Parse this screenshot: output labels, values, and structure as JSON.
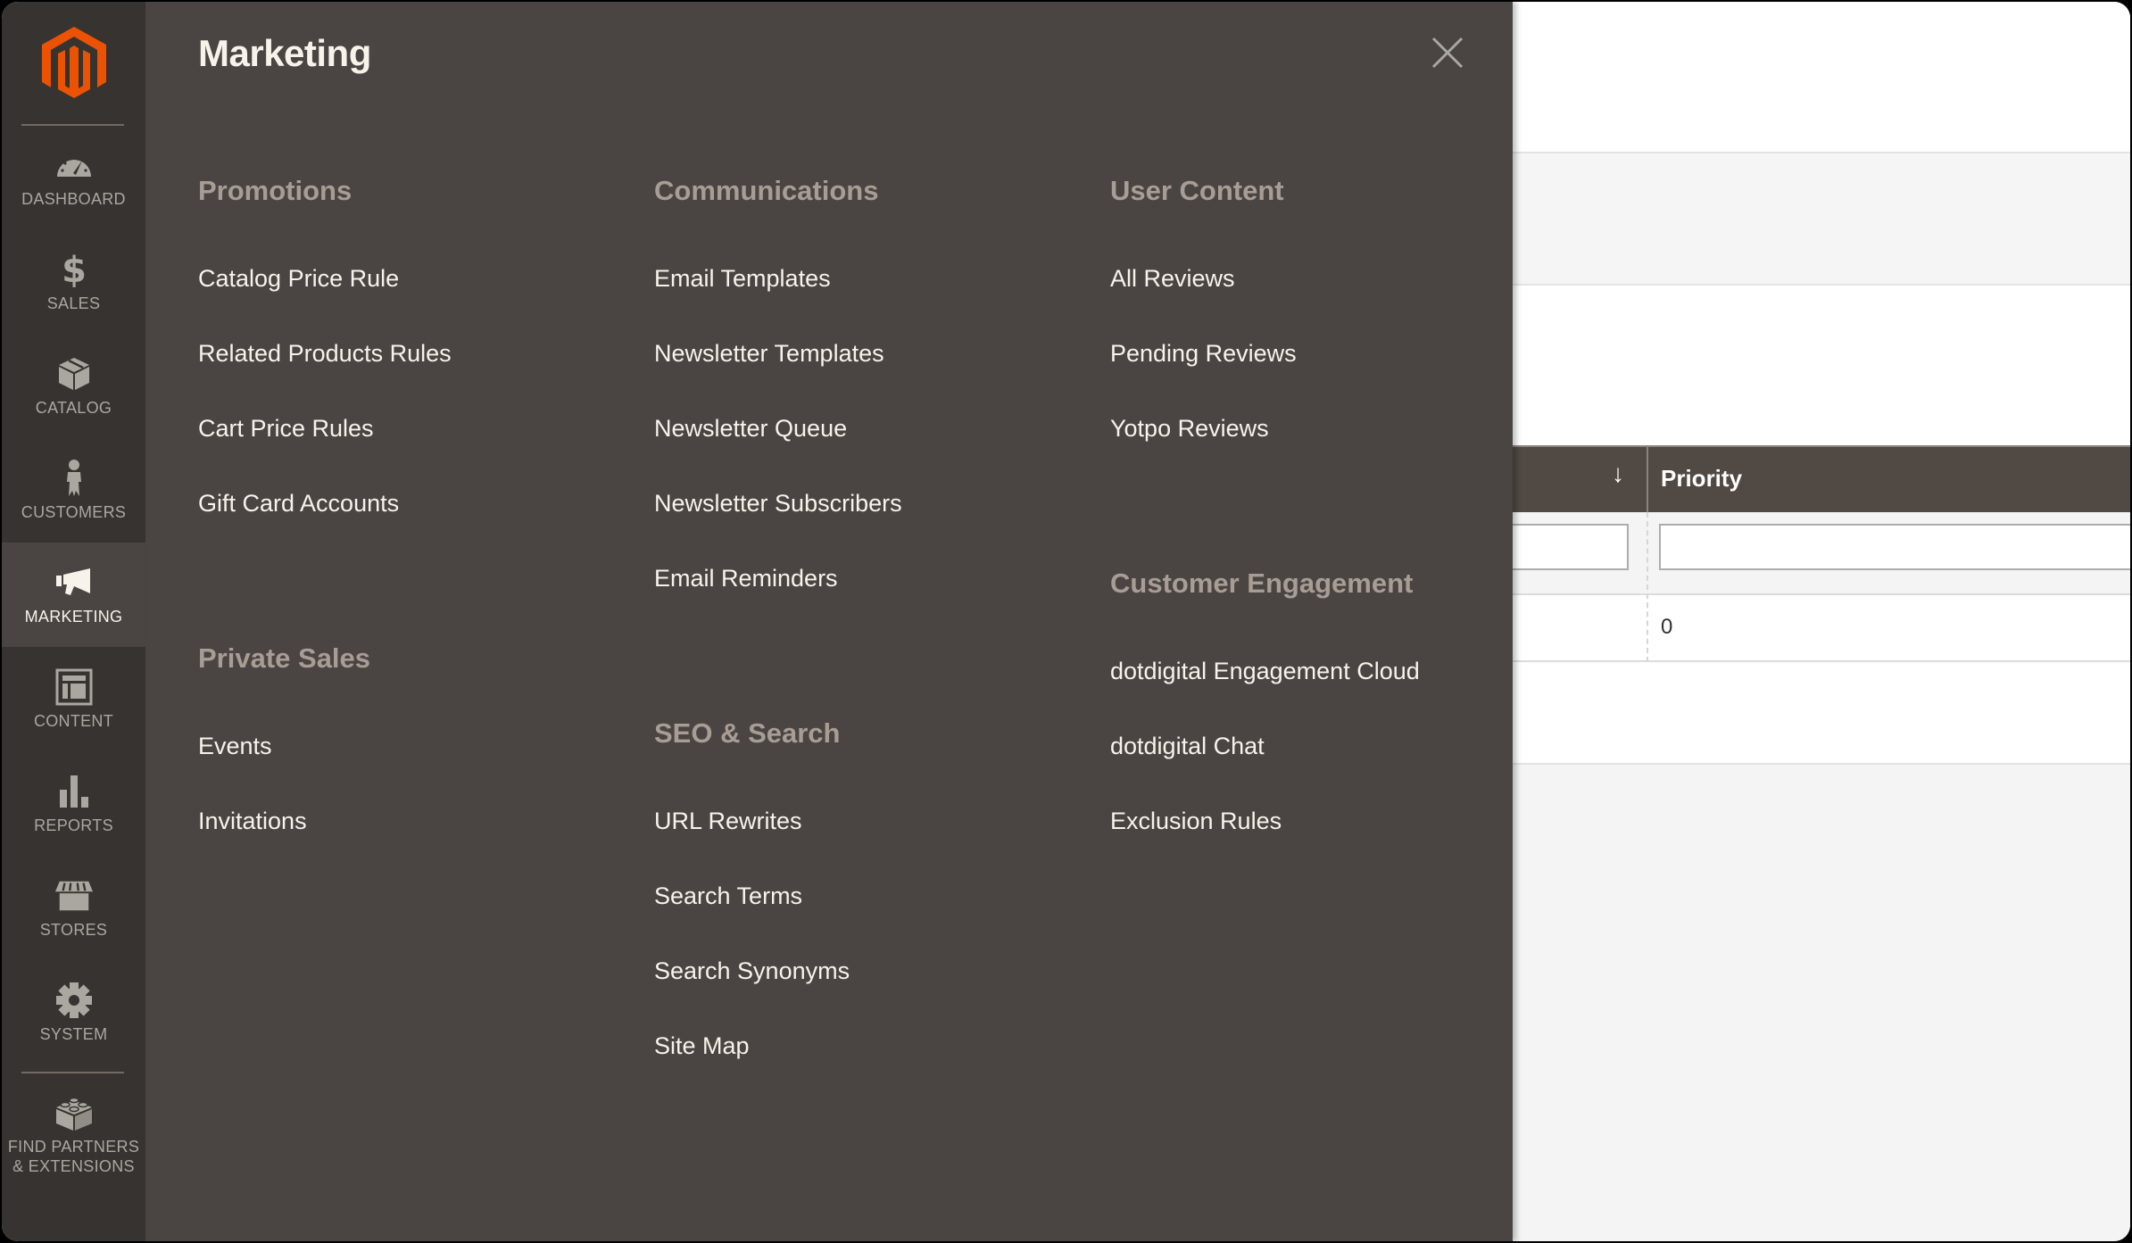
{
  "sidebar": {
    "logo": "magento-logo",
    "items": [
      {
        "label": "Dashboard",
        "icon": "dashboard-icon",
        "active": false
      },
      {
        "label": "Sales",
        "icon": "dollar-icon",
        "active": false
      },
      {
        "label": "Catalog",
        "icon": "box-icon",
        "active": false
      },
      {
        "label": "Customers",
        "icon": "person-icon",
        "active": false
      },
      {
        "label": "Marketing",
        "icon": "megaphone-icon",
        "active": true
      },
      {
        "label": "Content",
        "icon": "layout-icon",
        "active": false
      },
      {
        "label": "Reports",
        "icon": "bar-chart-icon",
        "active": false
      },
      {
        "label": "Stores",
        "icon": "storefront-icon",
        "active": false
      },
      {
        "label": "System",
        "icon": "gear-icon",
        "active": false
      }
    ],
    "extensions": {
      "line1": "Find Partners",
      "line2": "& Extensions",
      "icon": "lego-brick-icon"
    }
  },
  "flyout": {
    "title": "Marketing",
    "close_icon": "close-icon",
    "groups": {
      "promotions": {
        "title": "Promotions",
        "items": [
          "Catalog Price Rule",
          "Related Products Rules",
          "Cart Price Rules",
          "Gift Card Accounts"
        ]
      },
      "private_sales": {
        "title": "Private Sales",
        "items": [
          "Events",
          "Invitations"
        ]
      },
      "communications": {
        "title": "Communications",
        "items": [
          "Email Templates",
          "Newsletter Templates",
          "Newsletter Queue",
          "Newsletter Subscribers",
          "Email Reminders"
        ]
      },
      "seo_search": {
        "title": "SEO & Search",
        "items": [
          "URL Rewrites",
          "Search Terms",
          "Search Synonyms",
          "Site Map"
        ]
      },
      "user_content": {
        "title": "User Content",
        "items": [
          "All Reviews",
          "Pending Reviews",
          "Yotpo Reviews"
        ]
      },
      "customer_engagement": {
        "title": "Customer Engagement",
        "items": [
          "dotdigital Engagement Cloud",
          "dotdigital Chat",
          "Exclusion Rules"
        ]
      }
    }
  },
  "background_grid": {
    "sort_indicator": "↓",
    "columns": [
      "Priority"
    ],
    "filter_values": [
      "",
      ""
    ],
    "rows": [
      {
        "priority": "0"
      }
    ]
  },
  "colors": {
    "brand_orange": "#eb5202",
    "sidebar_bg": "#373330",
    "flyout_bg": "#4a4542",
    "group_title": "#a79d95",
    "link_text": "#f7f3eb",
    "grid_header_bg": "#514943"
  }
}
